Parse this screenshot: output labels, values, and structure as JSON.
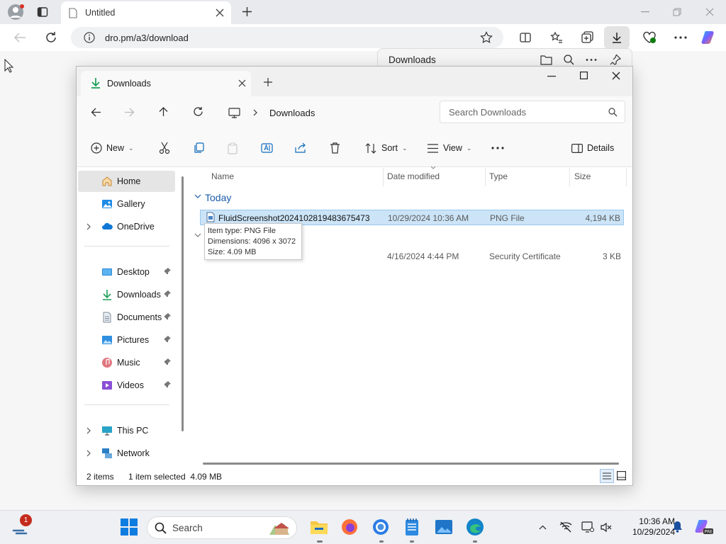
{
  "browser": {
    "tab_title": "Untitled",
    "url": "dro.pm/a3/download",
    "downloads_flyout_title": "Downloads"
  },
  "explorer": {
    "tab_title": "Downloads",
    "path": [
      "Downloads"
    ],
    "search_placeholder": "Search Downloads",
    "toolbar": {
      "new_label": "New",
      "sort_label": "Sort",
      "view_label": "View",
      "details_label": "Details"
    },
    "nav": [
      {
        "label": "Home",
        "icon": "home-icon",
        "pinned": false,
        "expandable": false,
        "selected": true
      },
      {
        "label": "Gallery",
        "icon": "gallery-icon",
        "pinned": false,
        "expandable": false
      },
      {
        "label": "OneDrive",
        "icon": "onedrive-icon",
        "pinned": false,
        "expandable": true
      },
      {
        "label": "Desktop",
        "icon": "desktop-icon",
        "pinned": true
      },
      {
        "label": "Downloads",
        "icon": "downloads-icon",
        "pinned": true
      },
      {
        "label": "Documents",
        "icon": "documents-icon",
        "pinned": true
      },
      {
        "label": "Pictures",
        "icon": "pictures-icon",
        "pinned": true
      },
      {
        "label": "Music",
        "icon": "music-icon",
        "pinned": true
      },
      {
        "label": "Videos",
        "icon": "videos-icon",
        "pinned": true
      },
      {
        "label": "This PC",
        "icon": "this-pc-icon",
        "expandable": true
      },
      {
        "label": "Network",
        "icon": "network-icon",
        "expandable": true
      }
    ],
    "columns": {
      "name": "Name",
      "date": "Date modified",
      "type": "Type",
      "size": "Size"
    },
    "group": "Today",
    "files": [
      {
        "name": "FluidScreenshot20241028194836754​73",
        "date": "10/29/2024 10:36 AM",
        "type": "PNG File",
        "size": "4,194 KB",
        "selected": true
      },
      {
        "name": "",
        "date": "4/16/2024 4:44 PM",
        "type": "Security Certificate",
        "size": "3 KB",
        "selected": false
      }
    ],
    "tooltip": {
      "line1": "Item type: PNG File",
      "line2": "Dimensions: 4096 x 3072",
      "line3": "Size: 4.09 MB"
    },
    "status": {
      "items": "2 items",
      "selection": "1 item selected  4.09 MB"
    }
  },
  "taskbar": {
    "search_label": "Search",
    "notification_count": "1",
    "time": "10:36 AM",
    "date": "10/29/2024"
  },
  "colors": {
    "accent": "#0067c0",
    "selection": "#cce4f7"
  }
}
